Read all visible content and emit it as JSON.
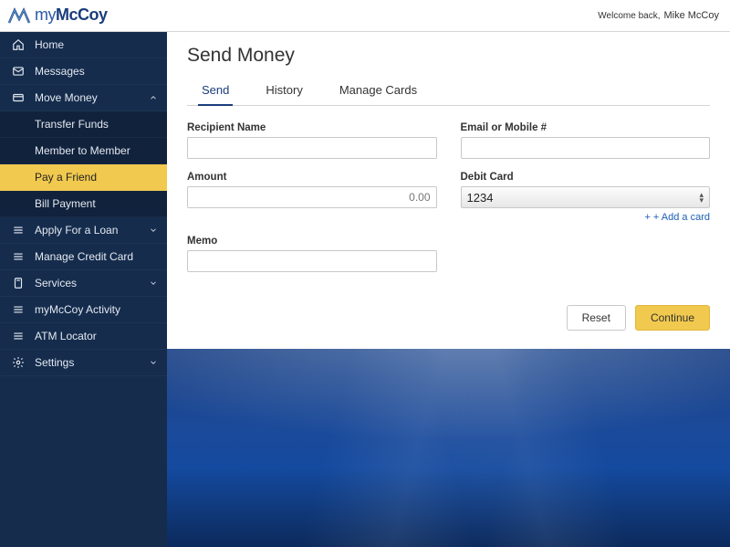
{
  "brand": {
    "prefix": "my",
    "name": "McCoy"
  },
  "header": {
    "welcome": "Welcome back,",
    "user": "Mike McCoy"
  },
  "sidebar": {
    "home": "Home",
    "messages": "Messages",
    "move_money": "Move Money",
    "transfer_funds": "Transfer Funds",
    "member_to_member": "Member to Member",
    "pay_a_friend": "Pay a Friend",
    "bill_payment": "Bill Payment",
    "apply_for_a_loan": "Apply For a Loan",
    "manage_credit_card": "Manage Credit Card",
    "services": "Services",
    "mymccoy_activity": "myMcCoy Activity",
    "atm_locator": "ATM Locator",
    "settings": "Settings"
  },
  "page": {
    "title": "Send Money"
  },
  "tabs": {
    "send": "Send",
    "history": "History",
    "manage_cards": "Manage Cards"
  },
  "form": {
    "recipient_label": "Recipient Name",
    "email_label": "Email or Mobile #",
    "amount_label": "Amount",
    "amount_placeholder": "0.00",
    "debit_label": "Debit Card",
    "debit_selected": "1234",
    "add_card": "+ + Add a card",
    "memo_label": "Memo"
  },
  "buttons": {
    "reset": "Reset",
    "continue": "Continue"
  }
}
